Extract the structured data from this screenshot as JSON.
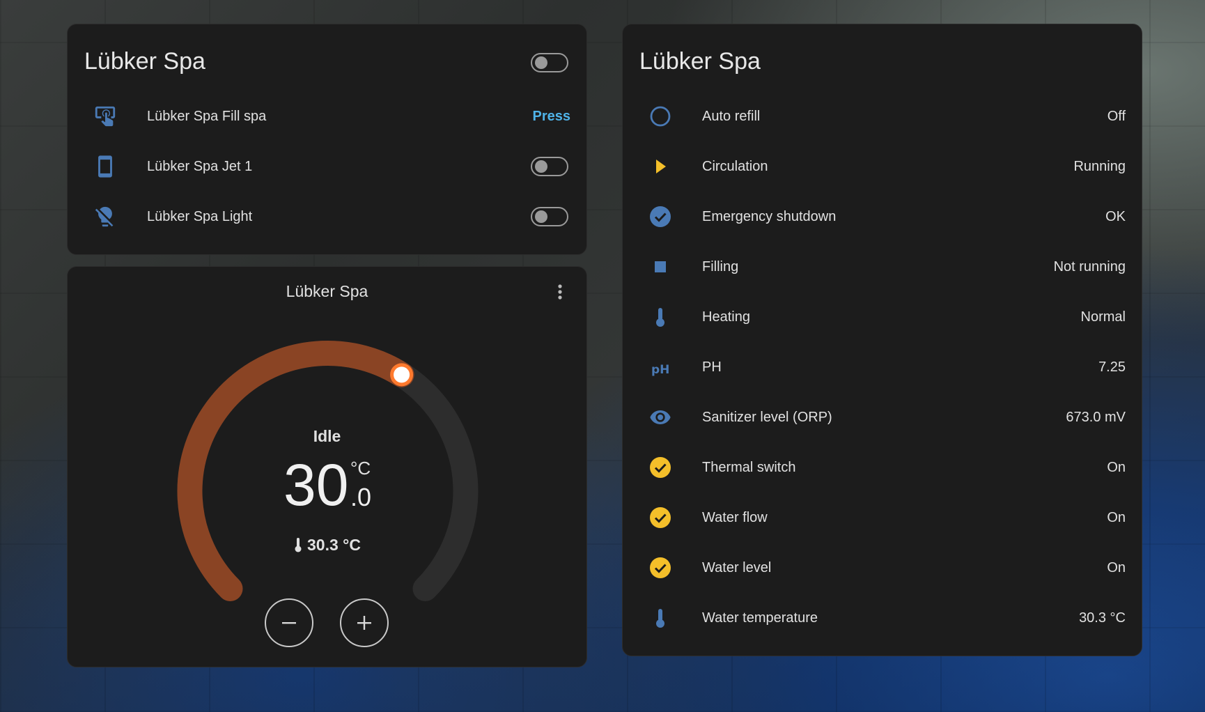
{
  "background": {
    "description_icon": "pool-background"
  },
  "entities_card": {
    "title": "Lübker Spa",
    "main_toggle": {
      "on": false
    },
    "rows": [
      {
        "icon": "gesture-tap-button-icon",
        "label": "Lübker Spa Fill spa",
        "action_label": "Press"
      },
      {
        "icon": "cellphone-icon",
        "label": "Lübker Spa Jet 1",
        "toggle_on": false
      },
      {
        "icon": "lightbulb-off-icon",
        "label": "Lübker Spa Light",
        "toggle_on": false
      }
    ]
  },
  "thermostat_card": {
    "title": "Lübker Spa",
    "menu_icon": "dots-vertical-icon",
    "status": "Idle",
    "target_whole": "30",
    "target_decimal": ".0",
    "unit": "°C",
    "current_temperature": "30.3 °C",
    "current_icon": "thermometer-icon",
    "minus_icon": "minus-icon",
    "plus_icon": "plus-icon",
    "target_fraction": 0.62,
    "colors": {
      "arc_active": "#8a4424",
      "arc_inactive": "#2d2d2d",
      "knob_border": "#ff7a2e"
    }
  },
  "sensors_card": {
    "title": "Lübker Spa",
    "rows": [
      {
        "icon": "circle-outline-icon",
        "label": "Auto refill",
        "value": "Off",
        "color": "#4a7ab5"
      },
      {
        "icon": "play-icon",
        "label": "Circulation",
        "value": "Running",
        "color": "#f4bf2a"
      },
      {
        "icon": "check-circle-icon",
        "label": "Emergency shutdown",
        "value": "OK",
        "color": "#4a7ab5"
      },
      {
        "icon": "stop-icon",
        "label": "Filling",
        "value": "Not running",
        "color": "#4a7ab5"
      },
      {
        "icon": "thermometer-icon",
        "label": "Heating",
        "value": "Normal",
        "color": "#4a7ab5"
      },
      {
        "icon": "ph-icon",
        "label": "PH",
        "value": "7.25",
        "color": "#4a7ab5"
      },
      {
        "icon": "eye-icon",
        "label": "Sanitizer level (ORP)",
        "value": "673.0 mV",
        "color": "#4a7ab5"
      },
      {
        "icon": "check-circle-icon",
        "label": "Thermal switch",
        "value": "On",
        "color": "#f4bf2a"
      },
      {
        "icon": "check-circle-icon",
        "label": "Water flow",
        "value": "On",
        "color": "#f4bf2a"
      },
      {
        "icon": "check-circle-icon",
        "label": "Water level",
        "value": "On",
        "color": "#f4bf2a"
      },
      {
        "icon": "thermometer-icon",
        "label": "Water temperature",
        "value": "30.3 °C",
        "color": "#4a7ab5"
      }
    ]
  }
}
